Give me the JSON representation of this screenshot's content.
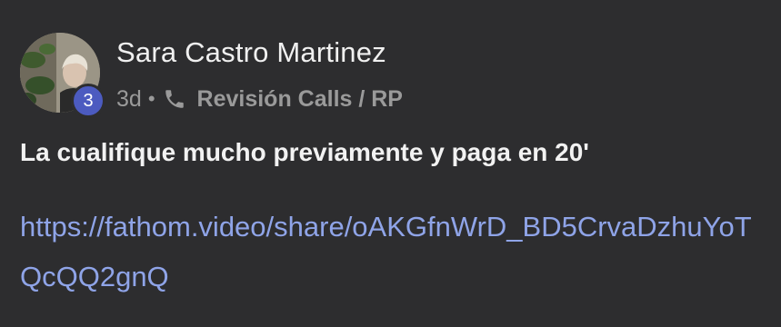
{
  "post": {
    "author": "Sara Castro Martinez",
    "badge_count": "3",
    "age": "3d",
    "separator": "•",
    "channel": "Revisión Calls / RP",
    "message": "La cualifique mucho previamente y paga en 20'",
    "link": "https://fathom.video/share/oAKGfnWrD_BD5CrvaDzhuYoTQcQQ2gnQ"
  },
  "icons": {
    "channel_icon": "phone-icon"
  },
  "colors": {
    "background": "#2d2d2f",
    "badge": "#4c5bc0",
    "link": "#8fa4e8",
    "meta": "#9a9a9a"
  }
}
